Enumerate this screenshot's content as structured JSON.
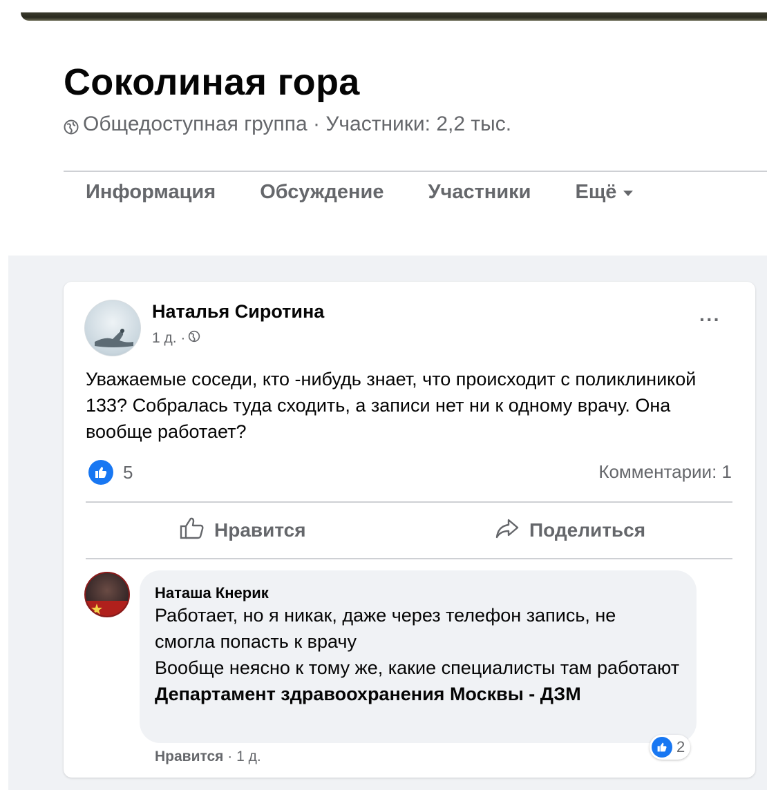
{
  "group": {
    "title": "Соколиная гора",
    "meta": "Общедоступная группа · Участники: 2,2 тыс."
  },
  "tabs": [
    {
      "label": "Информация"
    },
    {
      "label": "Обсуждение"
    },
    {
      "label": "Участники"
    },
    {
      "label": "Ещё"
    }
  ],
  "post": {
    "author": "Наталья Сиротина",
    "time": "1 д. ·",
    "more": "···",
    "text": "Уважаемые соседи, кто -нибудь знает, что происходит с поликлиникой 133? Собралась туда сходить, а записи нет ни к одному врачу. Она вообще работает?",
    "likes": "5",
    "comments": "Комментарии: 1",
    "actions": {
      "like": "Нравится",
      "share": "Поделиться"
    }
  },
  "comment": {
    "author": "Наташа Кнерик",
    "text_line1": "Работает, но я никак, даже через телефон запись, не смогла попасть к врачу",
    "text_line2_prefix": "Вообще неясно к тому же, какие специалисты там работают ",
    "mention": "Департамент здравоохранения Москвы - ДЗМ",
    "reactions": "2",
    "like_link": "Нравится",
    "time": "· 1 д."
  },
  "colors": {
    "accent": "#1877f2",
    "secondary_text": "#65676b",
    "feed_background": "#f0f2f5"
  },
  "icons": [
    "globe-icon",
    "more-icon",
    "like-reaction-icon",
    "thumbs-up-icon",
    "share-arrow-icon"
  ]
}
